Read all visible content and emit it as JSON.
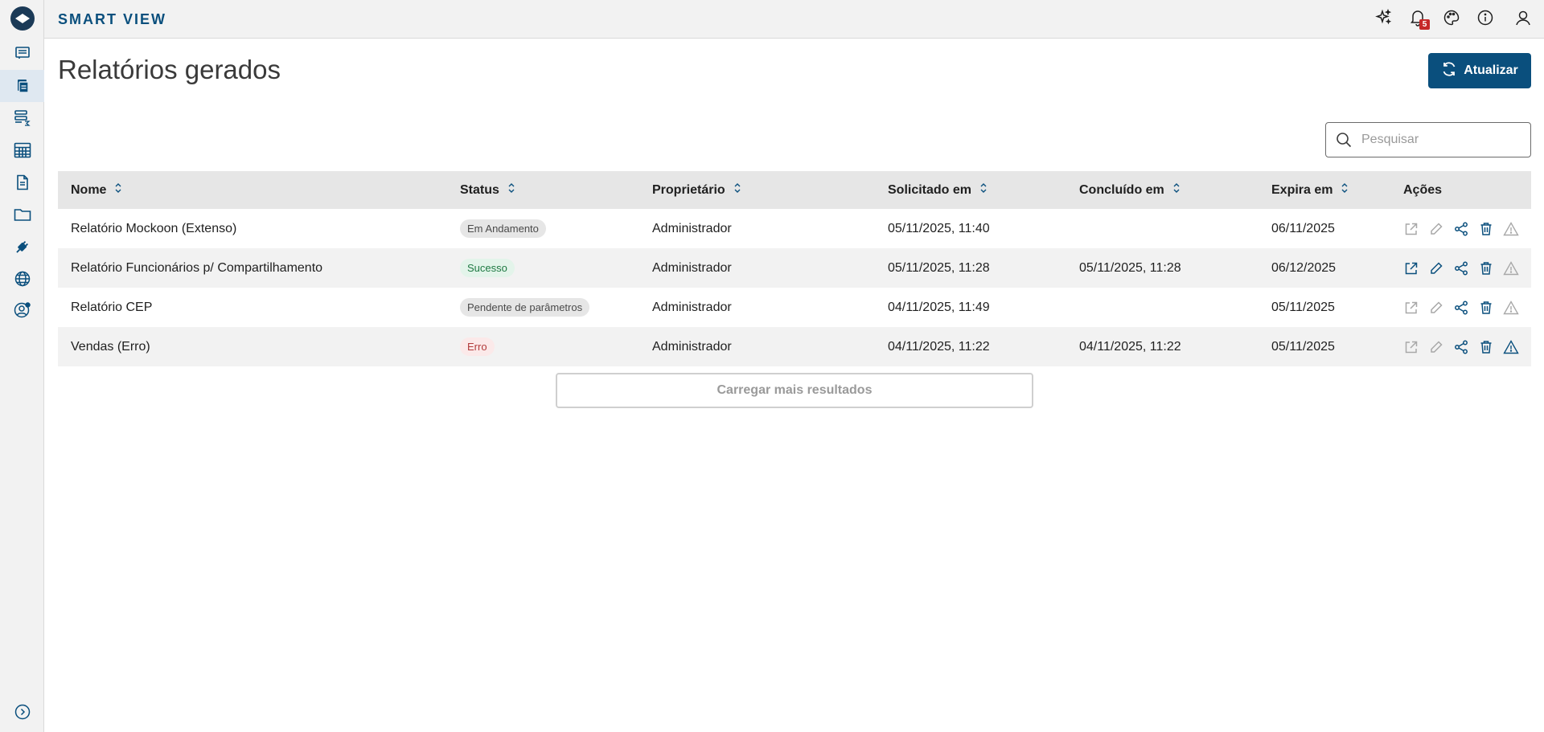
{
  "header": {
    "brand": "SMART VIEW",
    "notification_count": "5"
  },
  "sidebar": {
    "items": [
      {
        "icon": "reports-list-icon"
      },
      {
        "icon": "generated-reports-icon"
      },
      {
        "icon": "analysis-icon"
      },
      {
        "icon": "grid-table-icon"
      },
      {
        "icon": "document-icon"
      },
      {
        "icon": "folder-icon"
      },
      {
        "icon": "plug-icon"
      },
      {
        "icon": "globe-icon"
      },
      {
        "icon": "user-settings-icon"
      }
    ],
    "active_index": 1
  },
  "page": {
    "title": "Relatórios gerados",
    "refresh_label": "Atualizar",
    "search_placeholder": "Pesquisar",
    "load_more_label": "Carregar mais resultados"
  },
  "table": {
    "columns": {
      "nome": "Nome",
      "status": "Status",
      "proprietario": "Proprietário",
      "solicitado": "Solicitado em",
      "concluido": "Concluído em",
      "expira": "Expira em",
      "acoes": "Ações"
    },
    "rows": [
      {
        "nome": "Relatório Mockoon (Extenso)",
        "status": "Em Andamento",
        "status_kind": "andamento",
        "proprietario": "Administrador",
        "solicitado": "05/11/2025, 11:40",
        "concluido": "",
        "expira": "06/11/2025"
      },
      {
        "nome": "Relatório Funcionários p/ Compartilhamento",
        "status": "Sucesso",
        "status_kind": "sucesso",
        "proprietario": "Administrador",
        "solicitado": "05/11/2025, 11:28",
        "concluido": "05/11/2025, 11:28",
        "expira": "06/12/2025"
      },
      {
        "nome": "Relatório CEP",
        "status": "Pendente de parâmetros",
        "status_kind": "pendente",
        "proprietario": "Administrador",
        "solicitado": "04/11/2025, 11:49",
        "concluido": "",
        "expira": "05/11/2025"
      },
      {
        "nome": "Vendas (Erro)",
        "status": "Erro",
        "status_kind": "erro",
        "proprietario": "Administrador",
        "solicitado": "04/11/2025, 11:22",
        "concluido": "04/11/2025, 11:22",
        "expira": "05/11/2025"
      }
    ]
  },
  "colors": {
    "primary": "#0a4f7d",
    "active_icon": "#0a4f7d",
    "disabled_icon": "#a8a8a8",
    "success": "#1f7a43",
    "error": "#b23b3b"
  }
}
